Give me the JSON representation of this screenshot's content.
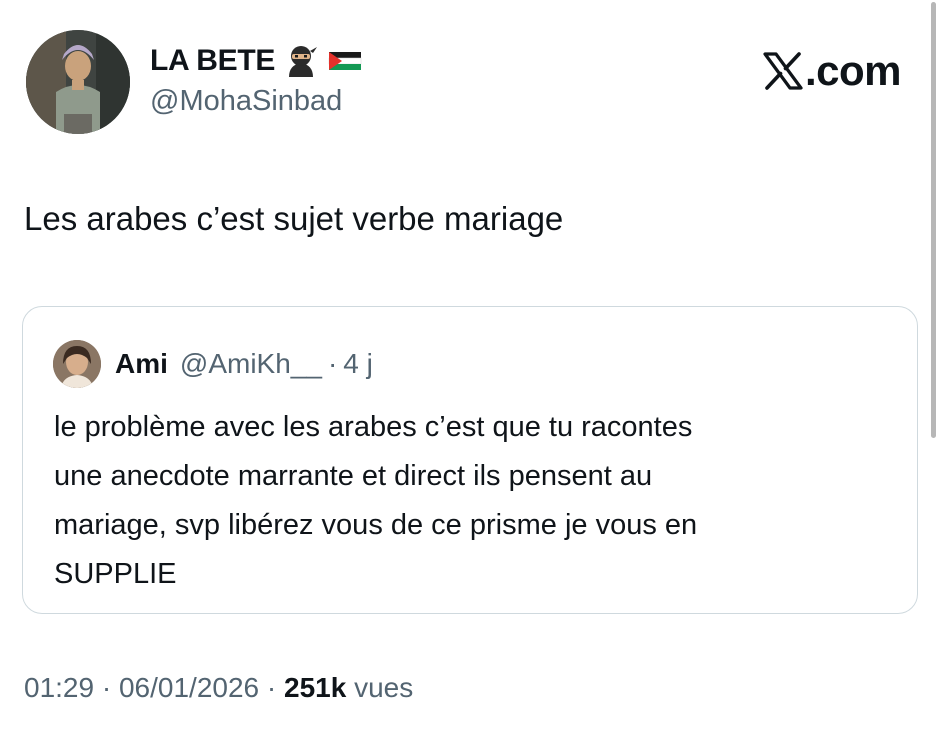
{
  "author": {
    "display_name": "LA BETE",
    "badges": [
      "ninja-emoji-icon",
      "palestine-flag-icon"
    ],
    "handle": "@MohaSinbad"
  },
  "brand": {
    "icon": "x-logo-icon",
    "text": ".com"
  },
  "tweet": {
    "text": "Les arabes c’est sujet verbe mariage"
  },
  "quoted_tweet": {
    "name": "Ami",
    "handle": "@AmiKh__",
    "separator": "·",
    "time": "4 j",
    "body": "le problème avec les arabes c’est que tu racontes\nune anecdote marrante et direct ils pensent au\nmariage, svp libérez vous de ce prisme je vous en\nSUPPLIE"
  },
  "meta": {
    "time": "01:29",
    "separator": "·",
    "date": "06/01/2026",
    "views_count": "251k",
    "views_label": "vues"
  },
  "colors": {
    "text": "#0f1419",
    "secondary_text": "#536471",
    "border": "#cfd9de",
    "background": "#ffffff"
  }
}
